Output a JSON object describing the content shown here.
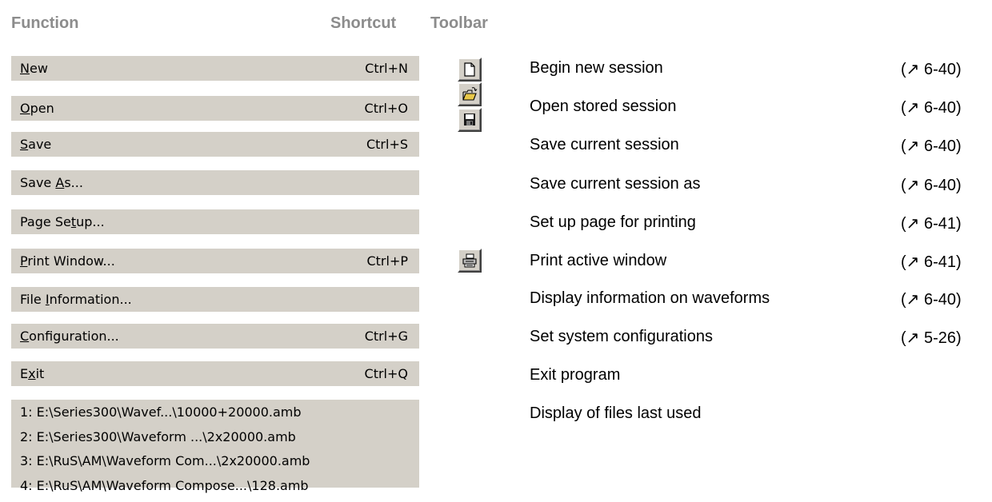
{
  "headers": {
    "function": "Function",
    "shortcut": "Shortcut",
    "toolbar": "Toolbar"
  },
  "menu": [
    {
      "pre": "",
      "mn": "N",
      "post": "ew",
      "shortcut": "Ctrl+N"
    },
    {
      "pre": "",
      "mn": "O",
      "post": "pen",
      "shortcut": "Ctrl+O"
    },
    {
      "pre": "",
      "mn": "S",
      "post": "ave",
      "shortcut": "Ctrl+S"
    },
    {
      "pre": "Save ",
      "mn": "A",
      "post": "s...",
      "shortcut": ""
    },
    {
      "pre": "Page Se",
      "mn": "t",
      "post": "up...",
      "shortcut": ""
    },
    {
      "pre": "",
      "mn": "P",
      "post": "rint Window...",
      "shortcut": "Ctrl+P"
    },
    {
      "pre": "File ",
      "mn": "I",
      "post": "nformation...",
      "shortcut": ""
    },
    {
      "pre": "",
      "mn": "C",
      "post": "onfiguration...",
      "shortcut": "Ctrl+G"
    },
    {
      "pre": "E",
      "mn": "x",
      "post": "it",
      "shortcut": "Ctrl+Q"
    }
  ],
  "recent_files": [
    "1: E:\\Series300\\Wavef...\\10000+20000.amb",
    "2: E:\\Series300\\Waveform ...\\2x20000.amb",
    "3: E:\\RuS\\AM\\Waveform Com...\\2x20000.amb",
    "4: E:\\RuS\\AM\\Waveform Compose...\\128.amb"
  ],
  "toolbar_icons": [
    "new-document-icon",
    "open-folder-icon",
    "save-disk-icon",
    "printer-icon"
  ],
  "descriptions": [
    {
      "text": "Begin new session",
      "ref": "(↗ 6-40)"
    },
    {
      "text": "Open stored session",
      "ref": "(↗ 6-40)"
    },
    {
      "text": "Save current session",
      "ref": "(↗ 6-40)"
    },
    {
      "text": "Save current session as",
      "ref": "(↗ 6-40)"
    },
    {
      "text": "Set up page for printing",
      "ref": "(↗ 6-41)"
    },
    {
      "text": "Print active window",
      "ref": "(↗ 6-41)"
    },
    {
      "text": "Display information on waveforms",
      "ref": "(↗ 6-40)"
    },
    {
      "text": "Set system configurations",
      "ref": "(↗ 5-26)"
    },
    {
      "text": "Exit program",
      "ref": ""
    },
    {
      "text": "Display of files last used",
      "ref": ""
    }
  ]
}
